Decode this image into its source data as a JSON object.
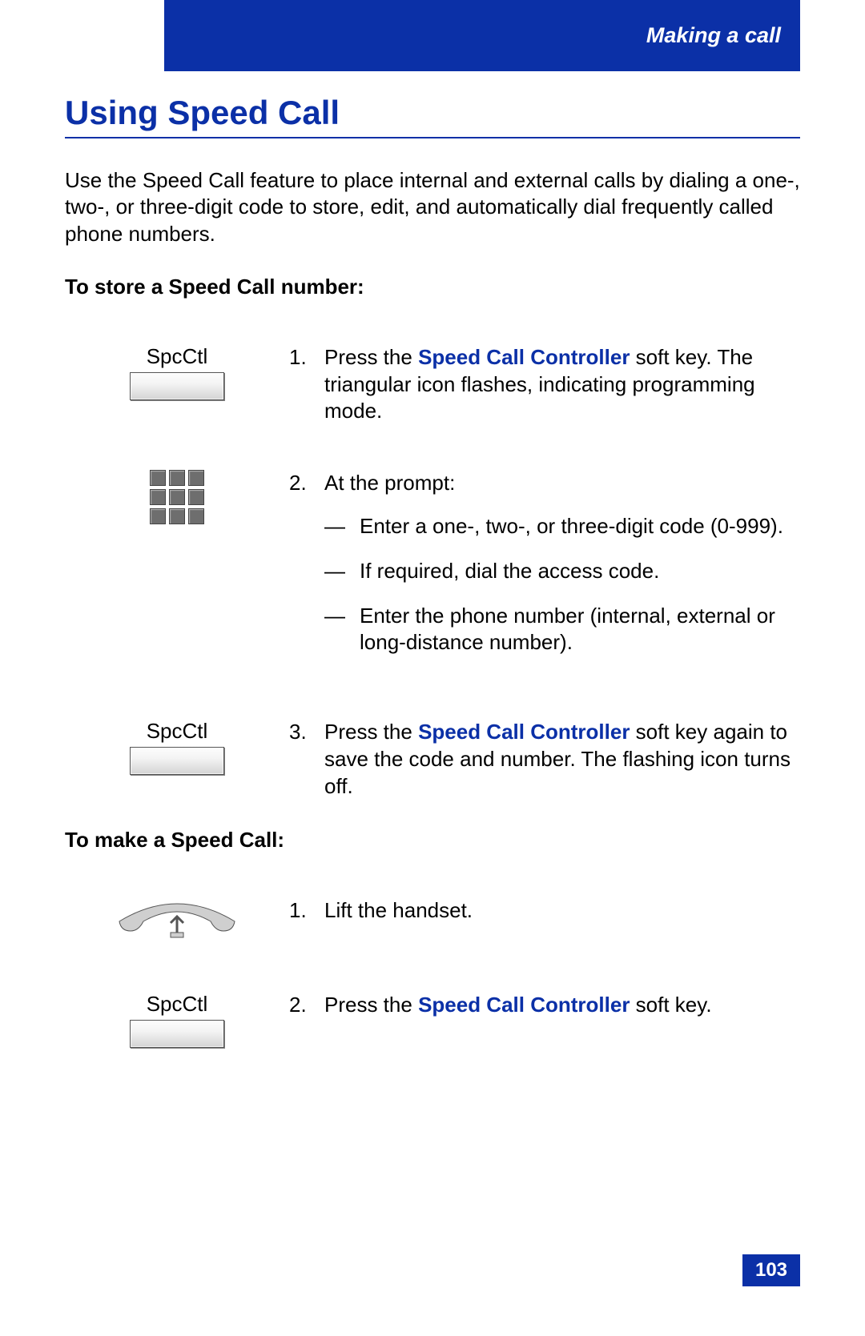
{
  "header": {
    "chapter": "Making a call"
  },
  "title": "Using Speed Call",
  "intro": "Use the Speed Call feature to place internal and external calls by dialing a one-, two-, or three-digit code to store, edit, and automatically dial frequently called phone numbers.",
  "section1": {
    "heading": "To store a Speed Call number:",
    "steps": [
      {
        "icon_label": "SpcCtl",
        "num": "1.",
        "pre": "Press the ",
        "emph": "Speed Call Controller",
        "post": " soft key. The triangular icon flashes, indicating programming mode."
      },
      {
        "num": "2.",
        "lead": "At the prompt:",
        "sub": [
          "Enter a one-, two-, or three-digit code (0-999).",
          "If required, dial the access code.",
          "Enter the phone number (internal, external or long-distance number)."
        ]
      },
      {
        "icon_label": "SpcCtl",
        "num": "3.",
        "pre": "Press the ",
        "emph": "Speed Call Controller",
        "post": " soft key again to save the code and number. The flashing icon turns off."
      }
    ]
  },
  "section2": {
    "heading": "To make a Speed Call:",
    "steps": [
      {
        "num": "1.",
        "text": "Lift the handset."
      },
      {
        "icon_label": "SpcCtl",
        "num": "2.",
        "pre": "Press the ",
        "emph": "Speed Call Controller",
        "post": " soft key."
      }
    ]
  },
  "page_number": "103",
  "dash": "—"
}
